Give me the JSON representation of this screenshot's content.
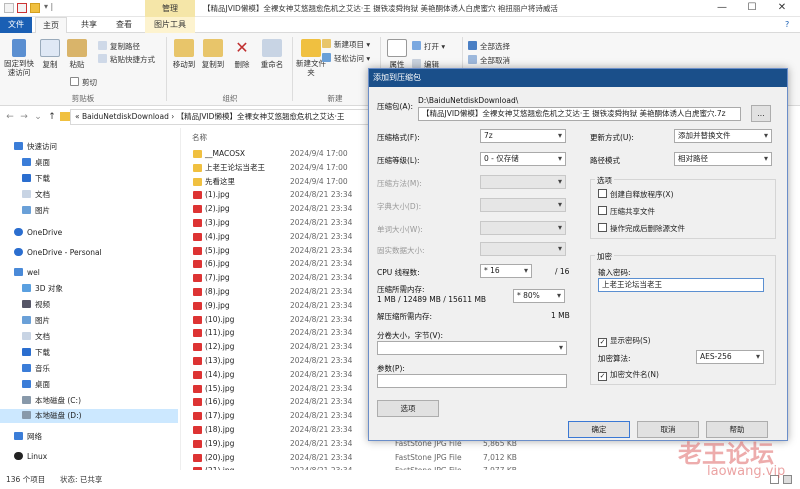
{
  "window": {
    "context_tab": "管理",
    "title": "【精品JVID懒模】全裸女神艾悠翘愈危机之艾达·王 摄铁凌舜拘狱 美艳酮体诱人白虎蜜穴 袍扭丽户将诗威活",
    "minimize": "—",
    "maximize": "☐",
    "close": "✕"
  },
  "ribbon_tabs": {
    "file": "文件",
    "home": "主页",
    "share": "共享",
    "view": "查看",
    "picture_tools": "图片工具"
  },
  "ribbon": {
    "pin_quick_access": "固定到快速访问",
    "copy": "复制",
    "paste": "粘贴",
    "copy_path": "复制路径",
    "paste_shortcut": "粘贴快捷方式",
    "cut": "剪切",
    "group_clipboard": "剪贴板",
    "move_to": "移动到",
    "copy_to": "复制到",
    "delete": "删除",
    "rename": "重命名",
    "group_organize": "组织",
    "new_folder": "新建文件夹",
    "new_item": "新建项目 ▾",
    "easy_access": "轻松访问 ▾",
    "group_new": "新建",
    "properties": "属性",
    "open": "打开 ▾",
    "edit": "编辑",
    "select_all": "全部选择",
    "select_none": "全部取消"
  },
  "address": {
    "path": "« BaiduNetdiskDownload › 【精品JVID懒模】全裸女神艾悠翘愈危机之艾达·王"
  },
  "nav": {
    "quick_access": "快速访问",
    "desktop": "桌面",
    "downloads": "下载",
    "documents": "文档",
    "pictures": "图片",
    "onedrive": "OneDrive",
    "onedrive_personal": "OneDrive - Personal",
    "this_pc": "wel",
    "objects3d": "3D 对象",
    "videos": "视频",
    "pictures2": "图片",
    "documents2": "文档",
    "downloads2": "下载",
    "music": "音乐",
    "desktop2": "桌面",
    "disk_c": "本地磁盘 (C:)",
    "disk_d": "本地磁盘 (D:)",
    "network": "网络",
    "linux": "Linux"
  },
  "list": {
    "col_name": "名称",
    "rows": [
      {
        "name": "__MACOSX",
        "date": "2024/9/4 17:00",
        "type": "",
        "size": ""
      },
      {
        "name": "上老王论坛当老王",
        "date": "2024/9/4 17:00",
        "type": "",
        "size": ""
      },
      {
        "name": "先看这里",
        "date": "2024/9/4 17:00",
        "type": "",
        "size": ""
      },
      {
        "name": "(1).jpg",
        "date": "2024/8/21 23:34",
        "type": "",
        "size": ""
      },
      {
        "name": "(2).jpg",
        "date": "2024/8/21 23:34",
        "type": "",
        "size": ""
      },
      {
        "name": "(3).jpg",
        "date": "2024/8/21 23:34",
        "type": "",
        "size": ""
      },
      {
        "name": "(4).jpg",
        "date": "2024/8/21 23:34",
        "type": "",
        "size": ""
      },
      {
        "name": "(5).jpg",
        "date": "2024/8/21 23:34",
        "type": "",
        "size": ""
      },
      {
        "name": "(6).jpg",
        "date": "2024/8/21 23:34",
        "type": "",
        "size": ""
      },
      {
        "name": "(7).jpg",
        "date": "2024/8/21 23:34",
        "type": "",
        "size": ""
      },
      {
        "name": "(8).jpg",
        "date": "2024/8/21 23:34",
        "type": "",
        "size": ""
      },
      {
        "name": "(9).jpg",
        "date": "2024/8/21 23:34",
        "type": "",
        "size": ""
      },
      {
        "name": "(10).jpg",
        "date": "2024/8/21 23:34",
        "type": "",
        "size": ""
      },
      {
        "name": "(11).jpg",
        "date": "2024/8/21 23:34",
        "type": "",
        "size": ""
      },
      {
        "name": "(12).jpg",
        "date": "2024/8/21 23:34",
        "type": "",
        "size": ""
      },
      {
        "name": "(13).jpg",
        "date": "2024/8/21 23:34",
        "type": "",
        "size": ""
      },
      {
        "name": "(14).jpg",
        "date": "2024/8/21 23:34",
        "type": "",
        "size": ""
      },
      {
        "name": "(15).jpg",
        "date": "2024/8/21 23:34",
        "type": "",
        "size": ""
      },
      {
        "name": "(16).jpg",
        "date": "2024/8/21 23:34",
        "type": "",
        "size": ""
      },
      {
        "name": "(17).jpg",
        "date": "2024/8/21 23:34",
        "type": "",
        "size": ""
      },
      {
        "name": "(18).jpg",
        "date": "2024/8/21 23:34",
        "type": "",
        "size": ""
      },
      {
        "name": "(19).jpg",
        "date": "2024/8/21 23:34",
        "type": "FastStone JPG File",
        "size": "5,865 KB"
      },
      {
        "name": "(20).jpg",
        "date": "2024/8/21 23:34",
        "type": "FastStone JPG File",
        "size": "7,012 KB"
      },
      {
        "name": "(21).jpg",
        "date": "2024/8/21 23:34",
        "type": "FastStone JPG File",
        "size": "7,977 KB"
      }
    ]
  },
  "status": {
    "count": "136 个项目",
    "state": "状态: 已共享"
  },
  "dialog": {
    "title": "添加到压缩包",
    "archive_label": "压缩包(A):",
    "archive_dir": "D:\\BaiduNetdiskDownload\\",
    "archive_name": "【精品JVID懒模】全裸女神艾悠翘愈危机之艾达·王 摄铁凌舜拘狱 美艳酮体诱人白虎蜜穴.7z",
    "browse": "...",
    "format_label": "压缩格式(F):",
    "format_value": "7z",
    "level_label": "压缩等级(L):",
    "level_value": "0 - 仅存储",
    "method_label": "压缩方法(M):",
    "dict_label": "字典大小(D):",
    "word_label": "单词大小(W):",
    "solid_label": "固实数据大小:",
    "threads_label": "CPU 线程数:",
    "threads_value": "* 16",
    "threads_max": "/ 16",
    "mem_label": "压缩所需内存:",
    "mem_value": "1 MB / 12489 MB / 15611 MB",
    "mem_pct": "* 80%",
    "demem_label": "解压缩所需内存:",
    "demem_value": "1 MB",
    "split_label": "分卷大小，字节(V):",
    "params_label": "参数(P):",
    "options_btn": "选项",
    "update_label": "更新方式(U):",
    "update_value": "添加并替换文件",
    "path_label": "路径模式",
    "path_value": "相对路径",
    "options_group": "选项",
    "opt_sfx": "创建自释放程序(X)",
    "opt_shared": "压缩共享文件",
    "opt_delete": "操作完成后删除源文件",
    "enc_group": "加密",
    "pwd_label": "输入密码:",
    "pwd_value": "上老王论坛当老王",
    "show_pwd": "显示密码(S)",
    "enc_method_label": "加密算法:",
    "enc_method_value": "AES-256",
    "enc_names": "加密文件名(N)",
    "ok": "确定",
    "cancel": "取消",
    "help": "帮助"
  },
  "watermark": {
    "cn": "老王论坛",
    "url": "laowang.vip"
  }
}
